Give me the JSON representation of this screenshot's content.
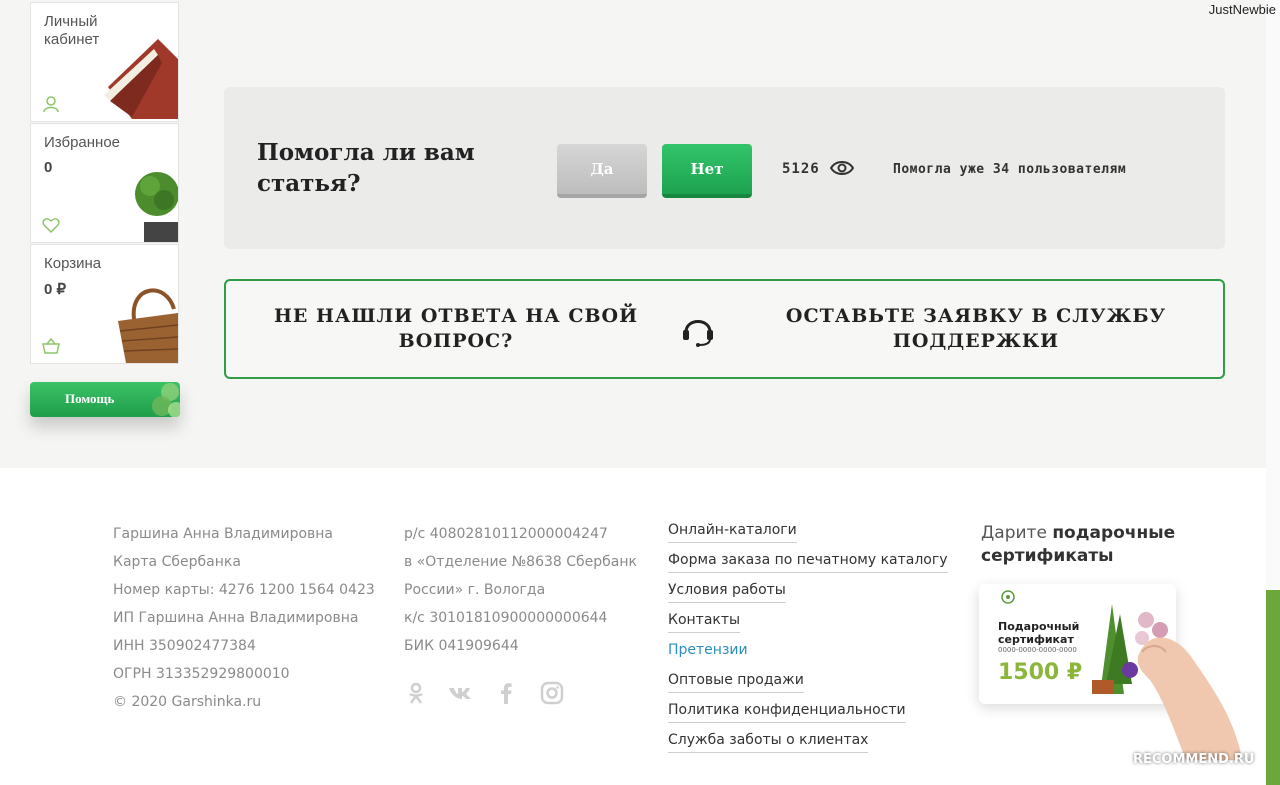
{
  "header": {
    "username": "JustNewbie"
  },
  "sidebar": {
    "account_label": "Личный кабинет",
    "favorites_label": "Избранное",
    "favorites_count": "0",
    "cart_label": "Корзина",
    "cart_value": "0 ₽",
    "help_button": "Помощь"
  },
  "feedback": {
    "question": "Помогла ли вам статья?",
    "yes_label": "Да",
    "no_label": "Нет",
    "views": "5126",
    "helped_text": "Помогла уже 34 пользователям"
  },
  "support": {
    "left_text": "НЕ НАШЛИ ОТВЕТА НА СВОЙ ВОПРОС?",
    "right_text": "ОСТАВЬТЕ ЗАЯВКУ В СЛУЖБУ ПОДДЕРЖКИ"
  },
  "footer": {
    "col1": [
      "Гаршина Анна Владимировна",
      "Карта Сбербанка",
      "Номер карты: 4276 1200 1564 0423",
      "ИП Гаршина Анна Владимировна",
      "ИНН 350902477384",
      "ОГРН 313352929800010",
      "© 2020 Garshinka.ru"
    ],
    "col2": [
      "р/с 40802810112000004247",
      "в «Отделение №8638 Сбербанк",
      "России» г. Вологда",
      "к/с 30101810900000000644",
      "БИК 041909644"
    ],
    "links": [
      "Онлайн-каталоги",
      "Форма заказа по печатному каталогу",
      "Условия работы",
      "Контакты",
      "Претензии",
      "Оптовые продажи",
      "Политика конфиденциальности",
      "Служба заботы о клиентах"
    ],
    "gift_title_plain": "Дарите ",
    "gift_title_bold": "подарочные сертификаты",
    "gift_card": {
      "title": "Подарочный сертификат",
      "number": "0000-0000-0000-0000",
      "price": "1500 ₽"
    }
  },
  "social_icons": [
    "odnoklassniki-icon",
    "vk-icon",
    "facebook-icon",
    "instagram-icon"
  ],
  "watermark": "RECOMMEND.RU",
  "colors": {
    "accent_green": "#1ea350",
    "link_active": "#2a8fbd",
    "border_green": "#2f9d44"
  }
}
